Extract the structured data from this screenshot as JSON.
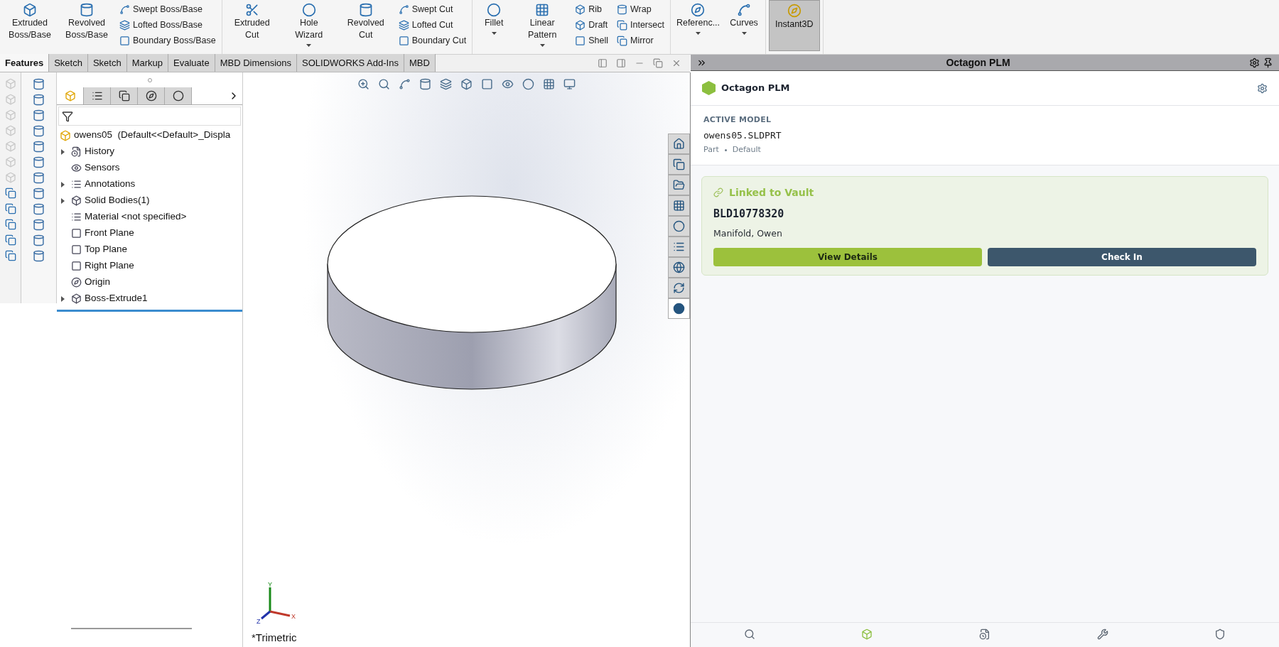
{
  "ribbon": {
    "groups": [
      {
        "items": [
          {
            "kind": "large",
            "label": "Extruded Boss/Base",
            "dropdown": false
          },
          {
            "kind": "large",
            "label": "Revolved Boss/Base",
            "dropdown": false
          },
          {
            "kind": "stack",
            "labels": [
              "Swept Boss/Base",
              "Lofted Boss/Base",
              "Boundary Boss/Base"
            ]
          }
        ]
      },
      {
        "items": [
          {
            "kind": "large",
            "label": "Extruded Cut",
            "dropdown": false
          },
          {
            "kind": "large",
            "label": "Hole Wizard",
            "dropdown": true
          },
          {
            "kind": "large",
            "label": "Revolved Cut",
            "dropdown": false
          },
          {
            "kind": "stack",
            "labels": [
              "Swept Cut",
              "Lofted Cut",
              "Boundary Cut"
            ]
          }
        ]
      },
      {
        "items": [
          {
            "kind": "large",
            "label": "Fillet",
            "dropdown": true
          },
          {
            "kind": "large",
            "label": "Linear Pattern",
            "dropdown": true
          },
          {
            "kind": "stack",
            "labels": [
              "Rib",
              "Draft",
              "Shell"
            ]
          },
          {
            "kind": "stack",
            "labels": [
              "Wrap",
              "Intersect",
              "Mirror"
            ]
          }
        ]
      },
      {
        "items": [
          {
            "kind": "large",
            "label": "Referenc...",
            "dropdown": true
          },
          {
            "kind": "large",
            "label": "Curves",
            "dropdown": true
          }
        ]
      },
      {
        "items": [
          {
            "kind": "toggle",
            "label": "Instant3D",
            "on": true
          }
        ]
      }
    ]
  },
  "tabs": [
    {
      "label": "Features",
      "selected": true
    },
    {
      "label": "Sketch",
      "selected": false
    },
    {
      "label": "Sketch",
      "selected": false
    },
    {
      "label": "Markup",
      "selected": false
    },
    {
      "label": "Evaluate",
      "selected": false
    },
    {
      "label": "MBD Dimensions",
      "selected": false
    },
    {
      "label": "SOLIDWORKS Add-Ins",
      "selected": false
    },
    {
      "label": "MBD",
      "selected": false
    }
  ],
  "feature_manager": {
    "panel_tabs": [
      {
        "selected": true
      },
      {
        "selected": false
      },
      {
        "selected": false
      },
      {
        "selected": false
      },
      {
        "selected": false
      }
    ],
    "root": "owens05  (Default<<Default>_Displa",
    "items": [
      {
        "label": "History",
        "expandable": true
      },
      {
        "label": "Sensors",
        "expandable": false
      },
      {
        "label": "Annotations",
        "expandable": true
      },
      {
        "label": "Solid Bodies(1)",
        "expandable": true
      },
      {
        "label": "Material <not specified>",
        "expandable": false
      },
      {
        "label": "Front Plane",
        "expandable": false
      },
      {
        "label": "Top Plane",
        "expandable": false
      },
      {
        "label": "Right Plane",
        "expandable": false
      },
      {
        "label": "Origin",
        "expandable": false
      },
      {
        "label": "Boss-Extrude1",
        "expandable": true
      }
    ]
  },
  "viewport": {
    "triad": {
      "x": "X",
      "y": "Y",
      "z": "Z"
    },
    "view_name": "*Trimetric",
    "task_tabs": [
      {
        "selected": false
      },
      {
        "selected": false
      },
      {
        "selected": false
      },
      {
        "selected": false
      },
      {
        "selected": false
      },
      {
        "selected": false
      },
      {
        "selected": false
      },
      {
        "selected": false
      },
      {
        "selected": true
      }
    ]
  },
  "plm_panel": {
    "title": "Octagon PLM",
    "brand": "Octagon PLM",
    "active_model": {
      "heading": "ACTIVE MODEL",
      "file": "owens05.SLDPRT",
      "type": "Part",
      "configuration": "Default"
    },
    "vault": {
      "status": "Linked to Vault",
      "number": "BLD10778320",
      "owner": "Manifold, Owen",
      "buttons": [
        "View Details",
        "Check In"
      ]
    },
    "nav": [
      {
        "selected": false
      },
      {
        "selected": true
      },
      {
        "selected": false
      },
      {
        "selected": false
      },
      {
        "selected": false
      }
    ]
  }
}
